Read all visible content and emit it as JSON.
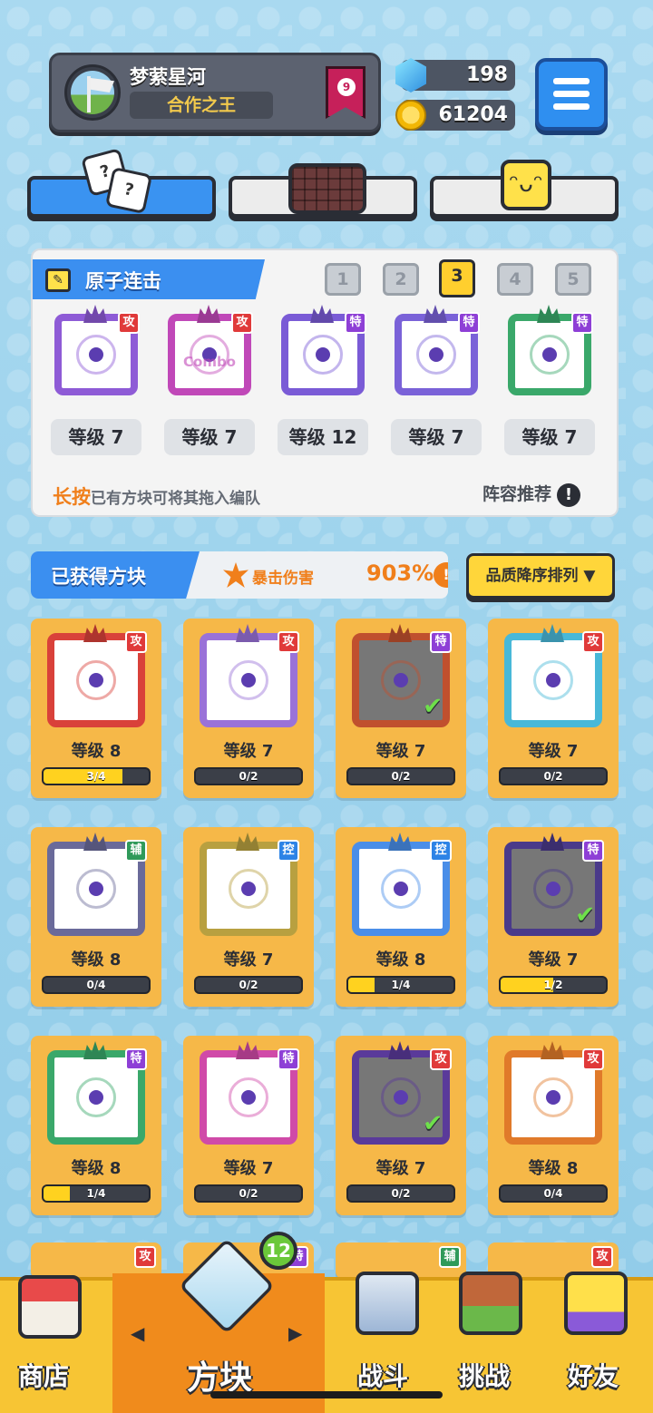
{
  "player": {
    "name": "梦萦星河",
    "title": "合作之王",
    "rank_level": "9"
  },
  "currency": {
    "gems": "198",
    "coins": "61204"
  },
  "deck": {
    "title": "原子连击",
    "pages": [
      "1",
      "2",
      "3",
      "4",
      "5"
    ],
    "selected_page": "3",
    "slots": [
      {
        "tag": "攻",
        "level": "等级 7",
        "color": "#8e5bd6",
        "art_text": ""
      },
      {
        "tag": "攻",
        "level": "等级 7",
        "color": "#c048b8",
        "art_text": "Combo"
      },
      {
        "tag": "特",
        "level": "等级 12",
        "color": "#7a5bd6",
        "art_text": ""
      },
      {
        "tag": "特",
        "level": "等级 7",
        "color": "#7a62d8",
        "art_text": ""
      },
      {
        "tag": "特",
        "level": "等级 7",
        "color": "#3aa86a",
        "art_text": ""
      }
    ],
    "hint_key": "长按",
    "hint_rest": "已有方块可将其拖入编队",
    "recommend": "阵容推荐",
    "recommend_icon": "!"
  },
  "owned": {
    "label": "已获得方块",
    "crit_label": "暴击伤害",
    "crit_value": "903%",
    "crit_icon": "!",
    "sort_label": "品质降序排列 ▼",
    "cards": [
      {
        "tag": "攻",
        "level": "等级 8",
        "progress": "3/4",
        "fill": 0.75,
        "color": "#d9413a",
        "checked": false
      },
      {
        "tag": "攻",
        "level": "等级 7",
        "progress": "0/2",
        "fill": 0,
        "color": "#9a72d8",
        "checked": false
      },
      {
        "tag": "特",
        "level": "等级 7",
        "progress": "0/2",
        "fill": 0,
        "color": "#c0502e",
        "checked": true
      },
      {
        "tag": "攻",
        "level": "等级 7",
        "progress": "0/2",
        "fill": 0,
        "color": "#48b8d8",
        "checked": false
      },
      {
        "tag": "辅",
        "level": "等级 8",
        "progress": "0/4",
        "fill": 0,
        "color": "#6a6a9a",
        "checked": false
      },
      {
        "tag": "控",
        "level": "等级 7",
        "progress": "0/2",
        "fill": 0,
        "color": "#b8a040",
        "checked": false
      },
      {
        "tag": "控",
        "level": "等级 8",
        "progress": "1/4",
        "fill": 0.25,
        "color": "#4a8ee8",
        "checked": false
      },
      {
        "tag": "特",
        "level": "等级 7",
        "progress": "1/2",
        "fill": 0.5,
        "color": "#4a3a8a",
        "checked": true
      },
      {
        "tag": "特",
        "level": "等级 8",
        "progress": "1/4",
        "fill": 0.25,
        "color": "#3aa86a",
        "checked": false
      },
      {
        "tag": "特",
        "level": "等级 7",
        "progress": "0/2",
        "fill": 0,
        "color": "#d04aa8",
        "checked": false
      },
      {
        "tag": "攻",
        "level": "等级 7",
        "progress": "0/2",
        "fill": 0,
        "color": "#5a3a9a",
        "checked": true
      },
      {
        "tag": "攻",
        "level": "等级 8",
        "progress": "0/4",
        "fill": 0,
        "color": "#e07a2a",
        "checked": false
      }
    ],
    "partial_tags": [
      "攻",
      "特",
      "辅",
      "攻"
    ]
  },
  "nav": {
    "shop": "商店",
    "blocks": "方块",
    "battle": "战斗",
    "challenge": "挑战",
    "friends": "好友",
    "blocks_badge": "12"
  }
}
